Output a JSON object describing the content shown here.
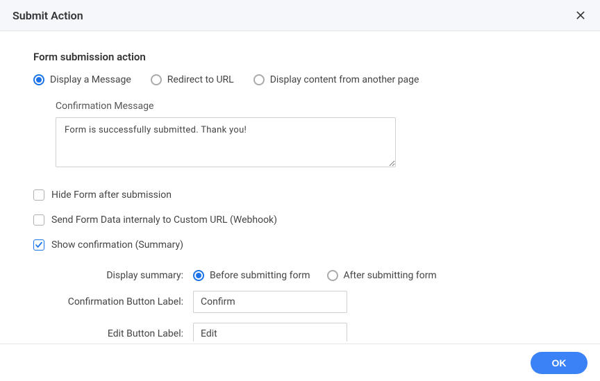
{
  "header": {
    "title": "Submit Action"
  },
  "section": {
    "title": "Form submission action"
  },
  "action_radios": {
    "display_message": "Display a Message",
    "redirect": "Redirect to URL",
    "display_content": "Display content from another page"
  },
  "confirmation": {
    "label": "Confirmation Message",
    "value": "Form is successfully submitted. Thank you!"
  },
  "checkboxes": {
    "hide_form": "Hide Form after submission",
    "send_webhook": "Send Form Data internaly to Custom URL (Webhook)",
    "show_summary": "Show confirmation (Summary)"
  },
  "summary": {
    "display_label": "Display summary:",
    "before": "Before submitting form",
    "after": "After submitting form",
    "confirm_btn_label_label": "Confirmation Button Label:",
    "confirm_btn_value": "Confirm",
    "edit_btn_label_label": "Edit Button Label:",
    "edit_btn_value": "Edit"
  },
  "footer": {
    "ok": "OK"
  }
}
